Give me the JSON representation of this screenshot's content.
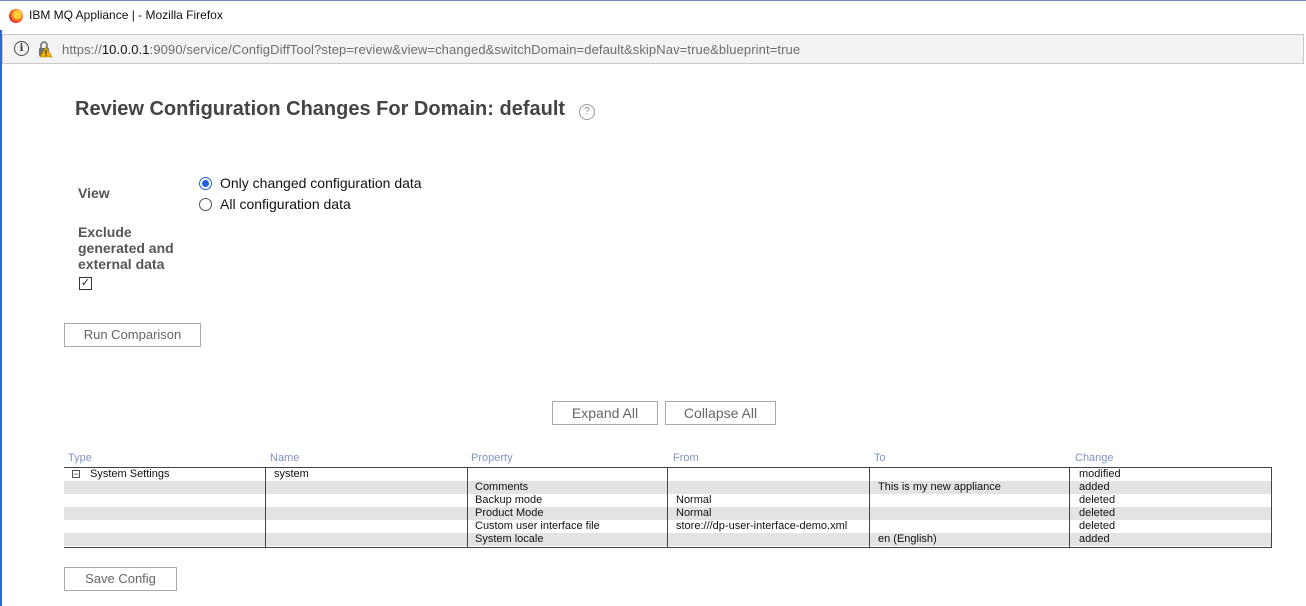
{
  "window": {
    "title": "IBM MQ Appliance | - Mozilla Firefox"
  },
  "urlbar": {
    "prefix": "https://",
    "host": "10.0.0.1",
    "rest": ":9090/service/ConfigDiffTool?step=review&view=changed&switchDomain=default&skipNav=true&blueprint=true"
  },
  "page": {
    "title": "Review Configuration Changes For Domain: default",
    "help_glyph": "?"
  },
  "form": {
    "view_label": "View",
    "view_options": [
      "Only changed configuration data",
      "All configuration data"
    ],
    "view_selected": "Only changed configuration data",
    "exclude_label_lines": [
      "Exclude",
      "generated and",
      "external data"
    ],
    "exclude_checked": true,
    "checkbox_glyph": "✓",
    "run_button": "Run Comparison"
  },
  "tree_controls": {
    "expand_all": "Expand All",
    "collapse_all": "Collapse All"
  },
  "table": {
    "headers": [
      "Type",
      "Name",
      "Property",
      "From",
      "To",
      "Change"
    ],
    "rows": [
      [
        "System Settings",
        "system",
        "",
        "",
        "",
        "modified"
      ],
      [
        "",
        "",
        "Comments",
        "",
        "This is my new appliance",
        "added"
      ],
      [
        "",
        "",
        "Backup mode",
        "Normal",
        "",
        "deleted"
      ],
      [
        "",
        "",
        "Product Mode",
        "Normal",
        "",
        "deleted"
      ],
      [
        "",
        "",
        "Custom user interface file",
        "store:///dp-user-interface-demo.xml",
        "",
        "deleted"
      ],
      [
        "",
        "",
        "System locale",
        "",
        "en (English)",
        "added"
      ]
    ],
    "collapse_glyph": "−"
  },
  "save_button": "Save Config",
  "icons": {
    "browser": "firefox-icon",
    "info": "info-icon",
    "lock": "insecure-lock-icon",
    "help": "help-icon",
    "collapse": "minus-box-icon"
  },
  "colors": {
    "radio_selected": "#1f62e0",
    "header_text": "#7f94c4",
    "stripe": "#e3e3e3"
  }
}
